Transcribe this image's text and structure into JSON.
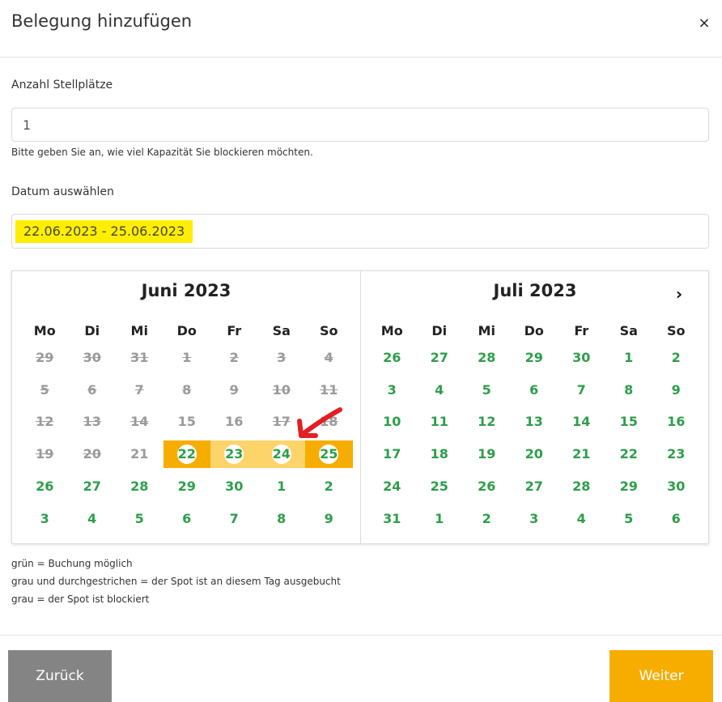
{
  "modal": {
    "title": "Belegung hinzufügen",
    "close_label": "×"
  },
  "capacity": {
    "label": "Anzahl Stellplätze",
    "value": "1",
    "help": "Bitte geben Sie an, wie viel Kapazität Sie blockieren möchten."
  },
  "date": {
    "label": "Datum auswählen",
    "value": "22.06.2023 - 25.06.2023"
  },
  "calendar": {
    "next_label": "›",
    "weekdays": [
      "Mo",
      "Di",
      "Mi",
      "Do",
      "Fr",
      "Sa",
      "So"
    ],
    "months": [
      {
        "title": "Juni 2023",
        "days": [
          {
            "d": "29",
            "s": "off"
          },
          {
            "d": "30",
            "s": "off"
          },
          {
            "d": "31",
            "s": "off"
          },
          {
            "d": "1",
            "s": "off"
          },
          {
            "d": "2",
            "s": "off"
          },
          {
            "d": "3",
            "s": "off"
          },
          {
            "d": "4",
            "s": "off"
          },
          {
            "d": "5",
            "s": "off"
          },
          {
            "d": "6",
            "s": "off"
          },
          {
            "d": "7",
            "s": "off"
          },
          {
            "d": "8",
            "s": "off"
          },
          {
            "d": "9",
            "s": "off"
          },
          {
            "d": "10",
            "s": "off"
          },
          {
            "d": "11",
            "s": "off"
          },
          {
            "d": "12",
            "s": "off"
          },
          {
            "d": "13",
            "s": "off"
          },
          {
            "d": "14",
            "s": "off"
          },
          {
            "d": "15",
            "s": "blocked"
          },
          {
            "d": "16",
            "s": "blocked"
          },
          {
            "d": "17",
            "s": "off"
          },
          {
            "d": "18",
            "s": "off"
          },
          {
            "d": "19",
            "s": "off"
          },
          {
            "d": "20",
            "s": "off"
          },
          {
            "d": "21",
            "s": "blocked"
          },
          {
            "d": "22",
            "s": "sel-end"
          },
          {
            "d": "23",
            "s": "sel-mid"
          },
          {
            "d": "24",
            "s": "sel-mid"
          },
          {
            "d": "25",
            "s": "sel-end"
          },
          {
            "d": "26",
            "s": "ok"
          },
          {
            "d": "27",
            "s": "ok"
          },
          {
            "d": "28",
            "s": "ok"
          },
          {
            "d": "29",
            "s": "ok"
          },
          {
            "d": "30",
            "s": "ok"
          },
          {
            "d": "1",
            "s": "ok"
          },
          {
            "d": "2",
            "s": "ok"
          },
          {
            "d": "3",
            "s": "ok"
          },
          {
            "d": "4",
            "s": "ok"
          },
          {
            "d": "5",
            "s": "ok"
          },
          {
            "d": "6",
            "s": "ok"
          },
          {
            "d": "7",
            "s": "ok"
          },
          {
            "d": "8",
            "s": "ok"
          },
          {
            "d": "9",
            "s": "ok"
          }
        ]
      },
      {
        "title": "Juli 2023",
        "days": [
          {
            "d": "26",
            "s": "ok"
          },
          {
            "d": "27",
            "s": "ok"
          },
          {
            "d": "28",
            "s": "ok"
          },
          {
            "d": "29",
            "s": "ok"
          },
          {
            "d": "30",
            "s": "ok"
          },
          {
            "d": "1",
            "s": "ok"
          },
          {
            "d": "2",
            "s": "ok"
          },
          {
            "d": "3",
            "s": "ok"
          },
          {
            "d": "4",
            "s": "ok"
          },
          {
            "d": "5",
            "s": "ok"
          },
          {
            "d": "6",
            "s": "ok"
          },
          {
            "d": "7",
            "s": "ok"
          },
          {
            "d": "8",
            "s": "ok"
          },
          {
            "d": "9",
            "s": "ok"
          },
          {
            "d": "10",
            "s": "ok"
          },
          {
            "d": "11",
            "s": "ok"
          },
          {
            "d": "12",
            "s": "ok"
          },
          {
            "d": "13",
            "s": "ok"
          },
          {
            "d": "14",
            "s": "ok"
          },
          {
            "d": "15",
            "s": "ok"
          },
          {
            "d": "16",
            "s": "ok"
          },
          {
            "d": "17",
            "s": "ok"
          },
          {
            "d": "18",
            "s": "ok"
          },
          {
            "d": "19",
            "s": "ok"
          },
          {
            "d": "20",
            "s": "ok"
          },
          {
            "d": "21",
            "s": "ok"
          },
          {
            "d": "22",
            "s": "ok"
          },
          {
            "d": "23",
            "s": "ok"
          },
          {
            "d": "24",
            "s": "ok"
          },
          {
            "d": "25",
            "s": "ok"
          },
          {
            "d": "26",
            "s": "ok"
          },
          {
            "d": "27",
            "s": "ok"
          },
          {
            "d": "28",
            "s": "ok"
          },
          {
            "d": "29",
            "s": "ok"
          },
          {
            "d": "30",
            "s": "ok"
          },
          {
            "d": "31",
            "s": "ok"
          },
          {
            "d": "1",
            "s": "ok"
          },
          {
            "d": "2",
            "s": "ok"
          },
          {
            "d": "3",
            "s": "ok"
          },
          {
            "d": "4",
            "s": "ok"
          },
          {
            "d": "5",
            "s": "ok"
          },
          {
            "d": "6",
            "s": "ok"
          }
        ]
      }
    ]
  },
  "legend": [
    "grün = Buchung möglich",
    "grau und durchgestrichen = der Spot ist an diesem Tag ausgebucht",
    "grau = der Spot ist blockiert"
  ],
  "buttons": {
    "back": "Zurück",
    "next": "Weiter"
  },
  "colors": {
    "available": "#2e9e4a",
    "unavailable": "#9a9a9a",
    "range_end": "#f6ad00",
    "range_middle": "#fdd46a",
    "date_highlight": "#ffee00",
    "annotation_arrow": "#e31e24"
  },
  "icons": {
    "close": "close-icon",
    "next_month": "chevron-right-icon",
    "annotation": "red-arrow-icon"
  }
}
